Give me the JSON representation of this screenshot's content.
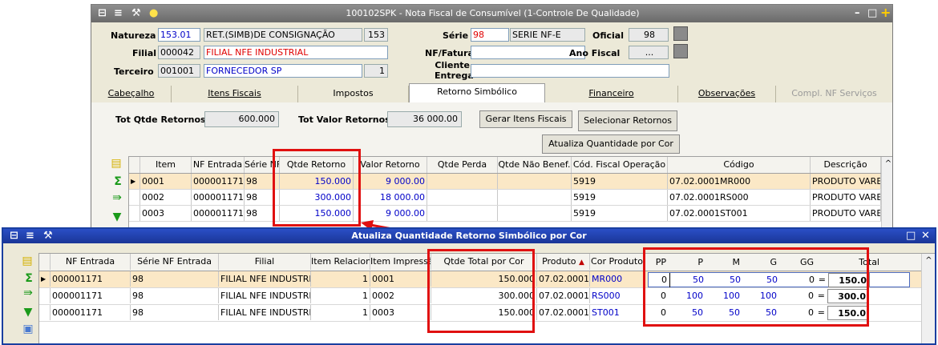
{
  "top_window": {
    "title": "100102SPK - Nota Fiscal de Consumível (1-Controle De Qualidade)",
    "natureza_label": "Natureza",
    "natureza_code": "153.01",
    "natureza_desc": "RET.(SIMB)DE CONSIGNAÇÃO",
    "natureza_num": "153",
    "filial_label": "Filial",
    "filial_code": "000042",
    "filial_name": "FILIAL NFE INDUSTRIAL",
    "terceiro_label": "Terceiro",
    "terceiro_code": "001001",
    "terceiro_name": "FORNECEDOR SP",
    "terceiro_num": "1",
    "serie_label": "Série",
    "serie_value": "98",
    "serie_desc": "SERIE NF-E",
    "oficial_label": "Oficial",
    "oficial_value": "98",
    "nf_fatura_label": "NF/Fatura",
    "ano_fiscal_label": "Ano Fiscal",
    "ano_fiscal_value": "...",
    "cliente_entrega_label1": "Cliente",
    "cliente_entrega_label2": "Entrega",
    "tabs": [
      "Cabeçalho",
      "Itens Fiscais",
      "Impostos",
      "Retorno Simbólico",
      "Financeiro",
      "Observações",
      "Compl. NF Serviços"
    ],
    "tot_qtde_label": "Tot Qtde Retornos",
    "tot_qtde_value": "600.000",
    "tot_valor_label": "Tot Valor Retornos",
    "tot_valor_value": "36 000.00",
    "btn_gerar": "Gerar Itens Fiscais",
    "btn_selecionar": "Selecionar Retornos",
    "btn_atualiza": "Atualiza Quantidade por Cor",
    "grid_headers": [
      "Item",
      "NF Entrada",
      "Série NF",
      "Qtde Retorno",
      "Valor Retorno",
      "Qtde Perda",
      "Qtde Não Benef.",
      "Cód. Fiscal Operação",
      "Código",
      "Descrição"
    ],
    "rows": [
      {
        "item": "0001",
        "nf": "000001171",
        "serie": "98",
        "qtde": "150.000",
        "valor": "9 000.00",
        "cfop": "5919",
        "codigo": "07.02.0001MR000",
        "desc": "PRODUTO VAREJ"
      },
      {
        "item": "0002",
        "nf": "000001171",
        "serie": "98",
        "qtde": "300.000",
        "valor": "18 000.00",
        "cfop": "5919",
        "codigo": "07.02.0001RS000",
        "desc": "PRODUTO VAREJ"
      },
      {
        "item": "0003",
        "nf": "000001171",
        "serie": "98",
        "qtde": "150.000",
        "valor": "9 000.00",
        "cfop": "5919",
        "codigo": "07.02.0001ST001",
        "desc": "PRODUTO VAREJ"
      }
    ]
  },
  "bottom_window": {
    "title": "Atualiza Quantidade Retorno Simbólico por Cor",
    "headers": [
      "NF Entrada",
      "Série NF Entrada",
      "Filial",
      "Item Relaciona",
      "Item Impressão",
      "Qtde Total por Cor",
      "Produto",
      "Cor Produto"
    ],
    "size_headers": [
      "PP",
      "P",
      "M",
      "G",
      "GG",
      "Total"
    ],
    "rows": [
      {
        "nf": "000001171",
        "serie": "98",
        "filial": "FILIAL NFE INDUSTRIAL",
        "rel": "1",
        "imp": "0001",
        "qtde": "150.000",
        "produto": "07.02.0001",
        "cor": "MR000",
        "pp": "0",
        "p": "50",
        "m": "50",
        "g": "50",
        "gg": "0",
        "eq": "=",
        "total": "150.0"
      },
      {
        "nf": "000001171",
        "serie": "98",
        "filial": "FILIAL NFE INDUSTRIAL",
        "rel": "1",
        "imp": "0002",
        "qtde": "300.000",
        "produto": "07.02.0001",
        "cor": "RS000",
        "pp": "0",
        "p": "100",
        "m": "100",
        "g": "100",
        "gg": "0",
        "eq": "=",
        "total": "300.0"
      },
      {
        "nf": "000001171",
        "serie": "98",
        "filial": "FILIAL NFE INDUSTRIAL",
        "rel": "1",
        "imp": "0003",
        "qtde": "150.000",
        "produto": "07.02.0001",
        "cor": "ST001",
        "pp": "0",
        "p": "50",
        "m": "50",
        "g": "50",
        "gg": "0",
        "eq": "=",
        "total": "150.0"
      }
    ]
  }
}
